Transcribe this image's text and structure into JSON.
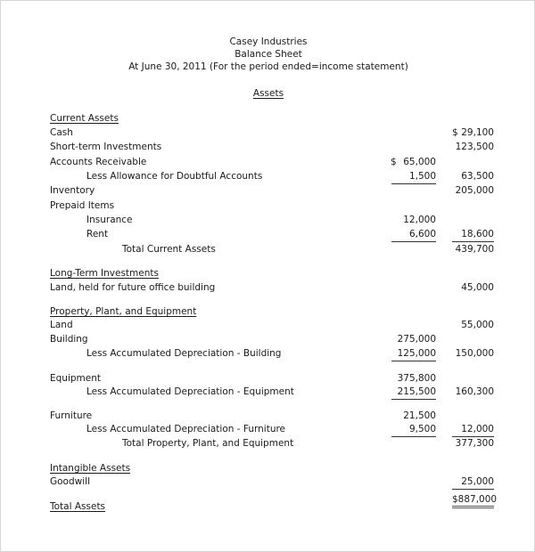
{
  "header": {
    "company": "Casey Industries",
    "statement": "Balance Sheet",
    "date_line": "At June 30, 2011 (For the period ended=income statement)",
    "section_title": "Assets"
  },
  "current_assets": {
    "heading": "Current Assets",
    "cash": {
      "label": "Cash",
      "currency": "$",
      "total": "29,100"
    },
    "short_term_investments": {
      "label": "Short-term Investments",
      "total": "123,500"
    },
    "accounts_receivable": {
      "label": "Accounts Receivable",
      "currency": "$",
      "amount": "65,000"
    },
    "allowance_doubtful": {
      "label": "Less Allowance for Doubtful Accounts",
      "amount": "1,500",
      "total": "63,500"
    },
    "inventory": {
      "label": "Inventory",
      "total": "205,000"
    },
    "prepaid_items": {
      "label": "Prepaid Items"
    },
    "insurance": {
      "label": "Insurance",
      "amount": "12,000"
    },
    "rent": {
      "label": "Rent",
      "amount": "6,600",
      "total": "18,600"
    },
    "total": {
      "label": "Total Current Assets",
      "total": "439,700"
    }
  },
  "long_term_investments": {
    "heading": "Long-Term Investments",
    "land_future": {
      "label": "Land, held for future office building",
      "total": "45,000"
    }
  },
  "ppe": {
    "heading": "Property, Plant, and Equipment",
    "land": {
      "label": "Land",
      "total": "55,000"
    },
    "building": {
      "label": "Building",
      "amount": "275,000"
    },
    "dep_building": {
      "label": "Less Accumulated Depreciation - Building",
      "amount": "125,000",
      "total": "150,000"
    },
    "equipment": {
      "label": "Equipment",
      "amount": "375,800"
    },
    "dep_equipment": {
      "label": "Less Accumulated Depreciation - Equipment",
      "amount": "215,500",
      "total": "160,300"
    },
    "furniture": {
      "label": "Furniture",
      "amount": "21,500"
    },
    "dep_furniture": {
      "label": "Less Accumulated Depreciation - Furniture",
      "amount": "9,500",
      "total": "12,000"
    },
    "total": {
      "label": "Total Property, Plant, and Equipment",
      "total": "377,300"
    }
  },
  "intangible_assets": {
    "heading": "Intangible Assets",
    "goodwill": {
      "label": "Goodwill",
      "total": "25,000"
    }
  },
  "total_assets": {
    "label": "Total Assets",
    "total": "$887,000"
  }
}
